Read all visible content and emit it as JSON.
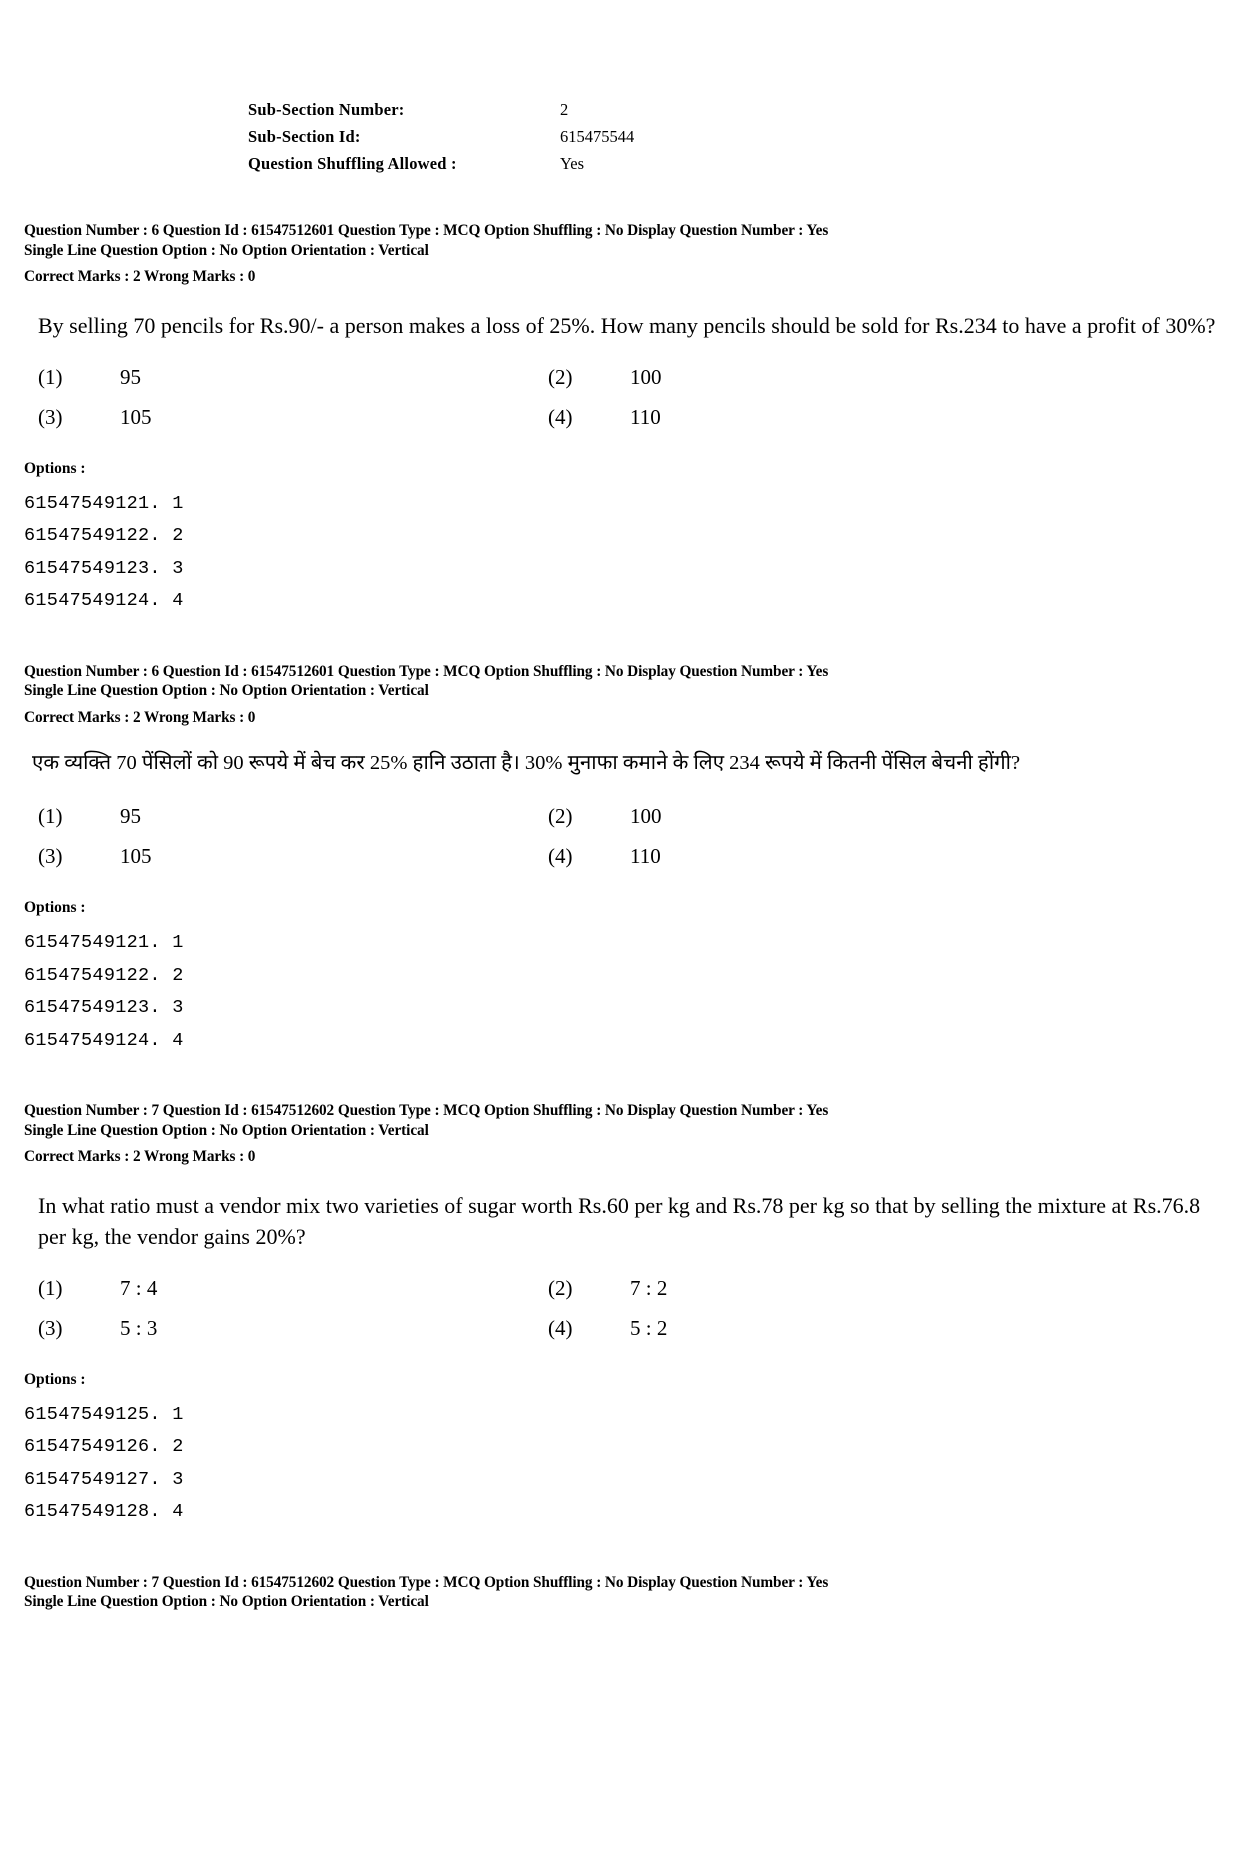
{
  "subsection": {
    "rows": [
      {
        "label": "Sub-Section Number:",
        "value": "2"
      },
      {
        "label": "Sub-Section Id:",
        "value": "615475544"
      },
      {
        "label": "Question Shuffling Allowed :",
        "value": "Yes"
      }
    ]
  },
  "questions": [
    {
      "meta_line1": "Question Number : 6  Question Id : 61547512601  Question Type : MCQ  Option Shuffling : No  Display Question Number : Yes",
      "meta_line2": "Single Line Question Option : No  Option Orientation : Vertical",
      "meta_marks": "Correct Marks : 2  Wrong Marks : 0",
      "body": "By selling 70 pencils for Rs.90/- a person makes a loss of 25%. How many pencils should be sold for Rs.234 to have a profit of 30%?",
      "choices": [
        {
          "num": "(1)",
          "text": "95"
        },
        {
          "num": "(2)",
          "text": "100"
        },
        {
          "num": "(3)",
          "text": "105"
        },
        {
          "num": "(4)",
          "text": "110"
        }
      ],
      "options_heading": "Options :",
      "option_ids": [
        "61547549121. 1",
        "61547549122. 2",
        "61547549123. 3",
        "61547549124. 4"
      ]
    },
    {
      "meta_line1": "Question Number : 6  Question Id : 61547512601  Question Type : MCQ  Option Shuffling : No  Display Question Number : Yes",
      "meta_line2": "Single Line Question Option : No  Option Orientation : Vertical",
      "meta_marks": "Correct Marks : 2  Wrong Marks : 0",
      "body": "एक व्यक्ति 70 पेंसिलों को 90 रूपये में बेच कर 25% हानि उठाता है। 30% मुनाफा कमाने के लिए 234 रूपये में कितनी पेंसिल बेचनी होंगी?",
      "choices": [
        {
          "num": "(1)",
          "text": "95"
        },
        {
          "num": "(2)",
          "text": "100"
        },
        {
          "num": "(3)",
          "text": "105"
        },
        {
          "num": "(4)",
          "text": "110"
        }
      ],
      "options_heading": "Options :",
      "option_ids": [
        "61547549121. 1",
        "61547549122. 2",
        "61547549123. 3",
        "61547549124. 4"
      ]
    },
    {
      "meta_line1": "Question Number : 7  Question Id : 61547512602  Question Type : MCQ  Option Shuffling : No  Display Question Number : Yes",
      "meta_line2": "Single Line Question Option : No  Option Orientation : Vertical",
      "meta_marks": "Correct Marks : 2  Wrong Marks : 0",
      "body": "In what ratio must a vendor mix two varieties of sugar worth Rs.60 per kg and Rs.78 per kg so that by selling the mixture at Rs.76.8 per kg, the vendor gains 20%?",
      "choices": [
        {
          "num": "(1)",
          "text": "7 : 4"
        },
        {
          "num": "(2)",
          "text": "7 : 2"
        },
        {
          "num": "(3)",
          "text": "5 : 3"
        },
        {
          "num": "(4)",
          "text": "5 : 2"
        }
      ],
      "options_heading": "Options :",
      "option_ids": [
        "61547549125. 1",
        "61547549126. 2",
        "61547549127. 3",
        "61547549128. 4"
      ]
    }
  ],
  "footer": {
    "meta_line1": "Question Number : 7  Question Id : 61547512602  Question Type : MCQ  Option Shuffling : No  Display Question Number : Yes",
    "meta_line2": "Single Line Question Option : No  Option Orientation : Vertical"
  }
}
